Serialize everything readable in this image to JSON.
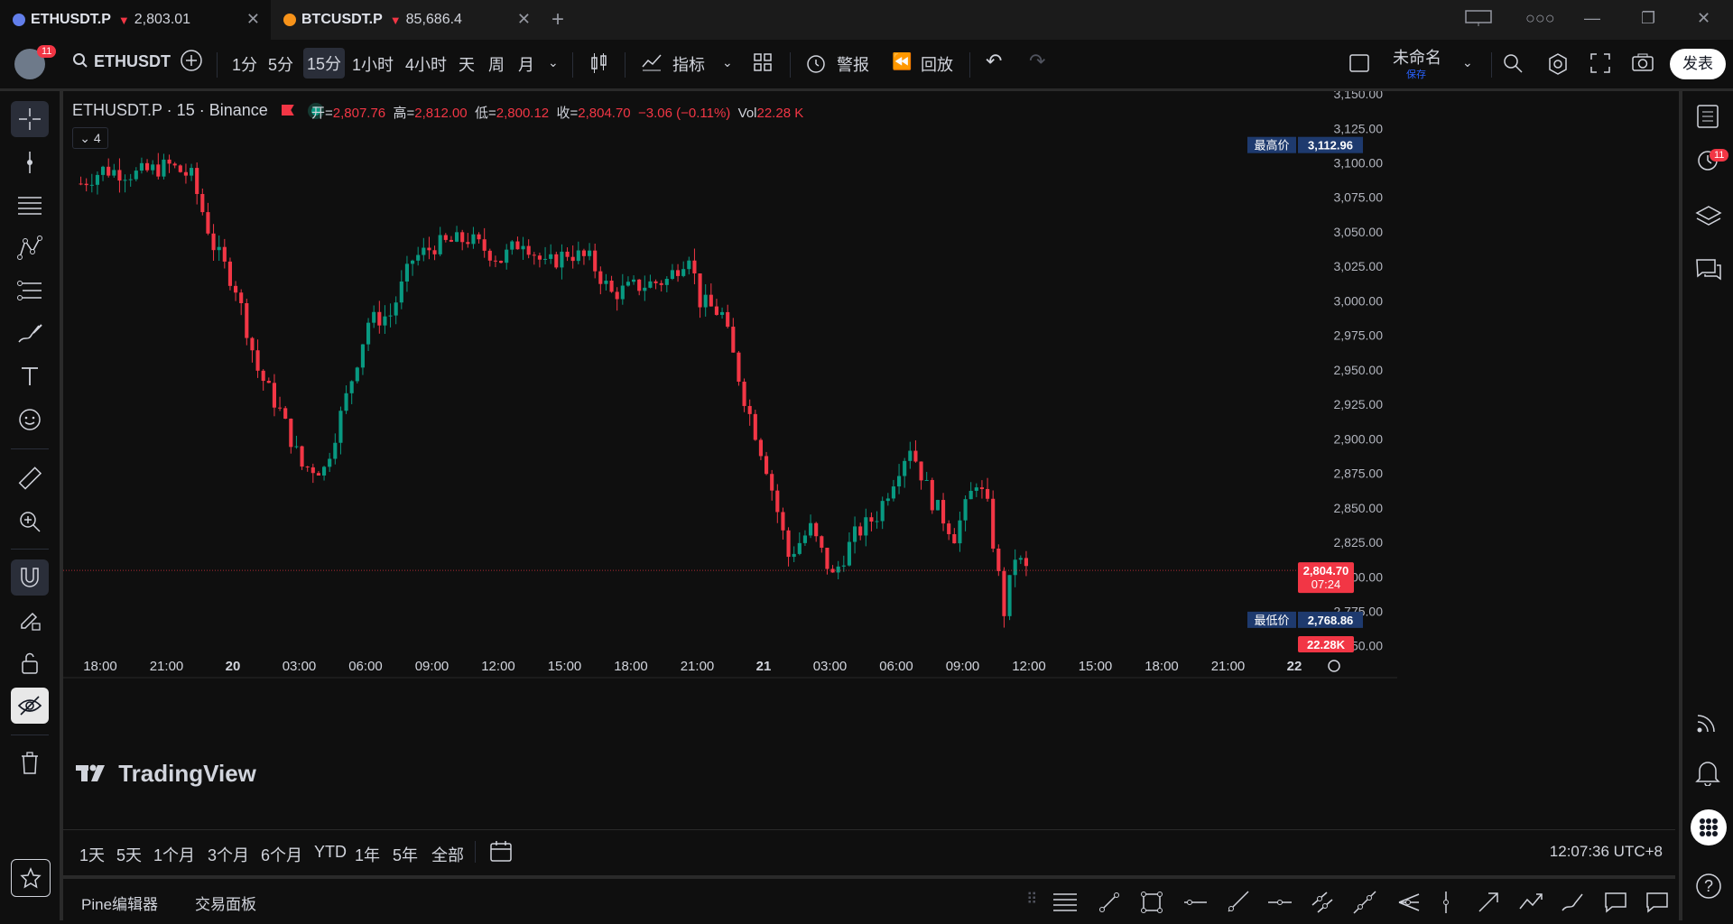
{
  "tabs": [
    {
      "symbol": "ETHUSDT.P",
      "price": "2,803.01",
      "coin_color": "#627eea"
    },
    {
      "symbol": "BTCUSDT.P",
      "price": "85,686.4",
      "coin_color": "#f7931a"
    }
  ],
  "toolbar": {
    "avatar_badge": "11",
    "symbol": "ETHUSDT",
    "intervals": [
      "1分",
      "5分",
      "15分",
      "1小时",
      "4小时",
      "天",
      "周",
      "月"
    ],
    "selected_interval": "15分",
    "indicators_label": "指标",
    "alert_label": "警报",
    "replay_label": "回放",
    "layout_name": "未命名",
    "save_label": "保存",
    "publish_label": "发表"
  },
  "legend": {
    "title": "ETHUSDT.P · 15 · Binance",
    "open_label": "开=",
    "open": "2,807.76",
    "high_label": "高=",
    "high": "2,812.00",
    "low_label": "低=",
    "low": "2,800.12",
    "close_label": "收=",
    "close": "2,804.70",
    "change": "−3.06 (−0.11%)",
    "vol_label": "Vol",
    "vol": "22.28 K",
    "collapsed_count": "4"
  },
  "chart_data": {
    "type": "candlestick",
    "symbol": "ETHUSDT.P",
    "exchange": "Binance",
    "interval": "15",
    "xlabels": [
      "18:00",
      "21:00",
      "20",
      "03:00",
      "06:00",
      "09:00",
      "12:00",
      "15:00",
      "18:00",
      "21:00",
      "21",
      "03:00",
      "06:00",
      "09:00",
      "12:00",
      "15:00",
      "18:00",
      "21:00",
      "22"
    ],
    "ylabels": [
      "3,150.00",
      "3,125.00",
      "3,100.00",
      "3,075.00",
      "3,050.00",
      "3,025.00",
      "3,000.00",
      "2,975.00",
      "2,950.00",
      "2,925.00",
      "2,900.00",
      "2,875.00",
      "2,850.00",
      "2,825.00",
      "2,800.00",
      "2,775.00",
      "2,750.00"
    ],
    "ylim": [
      2740,
      3152
    ],
    "series": [
      {
        "name": "ETHUSDT.P",
        "close_path": [
          {
            "x": "17:00",
            "y": 3085
          },
          {
            "x": "18:00",
            "y": 3095
          },
          {
            "x": "19:30",
            "y": 3092
          },
          {
            "x": "21:00",
            "y": 3098
          },
          {
            "x": "22:00",
            "y": 3090
          },
          {
            "x": "23:00",
            "y": 3040
          },
          {
            "x": "00:00",
            "y": 3010
          },
          {
            "x": "01:00",
            "y": 2950
          },
          {
            "x": "02:00",
            "y": 2920
          },
          {
            "x": "03:00",
            "y": 2880
          },
          {
            "x": "04:00",
            "y": 2878
          },
          {
            "x": "05:00",
            "y": 2930
          },
          {
            "x": "06:00",
            "y": 2985
          },
          {
            "x": "07:00",
            "y": 2990
          },
          {
            "x": "08:00",
            "y": 3030
          },
          {
            "x": "09:00",
            "y": 3040
          },
          {
            "x": "10:30",
            "y": 3045
          },
          {
            "x": "12:00",
            "y": 3030
          },
          {
            "x": "13:00",
            "y": 3045
          },
          {
            "x": "14:00",
            "y": 3025
          },
          {
            "x": "15:00",
            "y": 3035
          },
          {
            "x": "16:00",
            "y": 3030
          },
          {
            "x": "17:00",
            "y": 3005
          },
          {
            "x": "18:00",
            "y": 3010
          },
          {
            "x": "19:30",
            "y": 3015
          },
          {
            "x": "20:30",
            "y": 3035
          },
          {
            "x": "21:00",
            "y": 3000
          },
          {
            "x": "22:00",
            "y": 2990
          },
          {
            "x": "23:00",
            "y": 2930
          },
          {
            "x": "00:00",
            "y": 2880
          },
          {
            "x": "01:00",
            "y": 2815
          },
          {
            "x": "02:00",
            "y": 2835
          },
          {
            "x": "03:00",
            "y": 2800
          },
          {
            "x": "04:00",
            "y": 2830
          },
          {
            "x": "05:00",
            "y": 2845
          },
          {
            "x": "06:00",
            "y": 2880
          },
          {
            "x": "06:30",
            "y": 2895
          },
          {
            "x": "07:30",
            "y": 2855
          },
          {
            "x": "08:30",
            "y": 2830
          },
          {
            "x": "09:30",
            "y": 2870
          },
          {
            "x": "10:00",
            "y": 2850
          },
          {
            "x": "10:45",
            "y": 2775
          },
          {
            "x": "11:15",
            "y": 2815
          },
          {
            "x": "11:45",
            "y": 2805
          }
        ]
      }
    ],
    "highest": {
      "label": "最高价",
      "value": "3,112.96"
    },
    "lowest": {
      "label": "最低价",
      "value": "2,768.86"
    },
    "last": {
      "value": "2,804.70",
      "countdown": "07:24",
      "y": 2804.7
    },
    "volume_tag": "22.28K",
    "watermark": "TradingView",
    "colors": {
      "up": "#089981",
      "down": "#f23645"
    }
  },
  "range": {
    "buttons": [
      "1天",
      "5天",
      "1个月",
      "3个月",
      "6个月",
      "YTD",
      "1年",
      "5年",
      "全部"
    ],
    "clock": "12:07:36 UTC+8"
  },
  "panel": {
    "pine_label": "Pine编辑器",
    "trading_label": "交易面板"
  },
  "right_badge": "11"
}
